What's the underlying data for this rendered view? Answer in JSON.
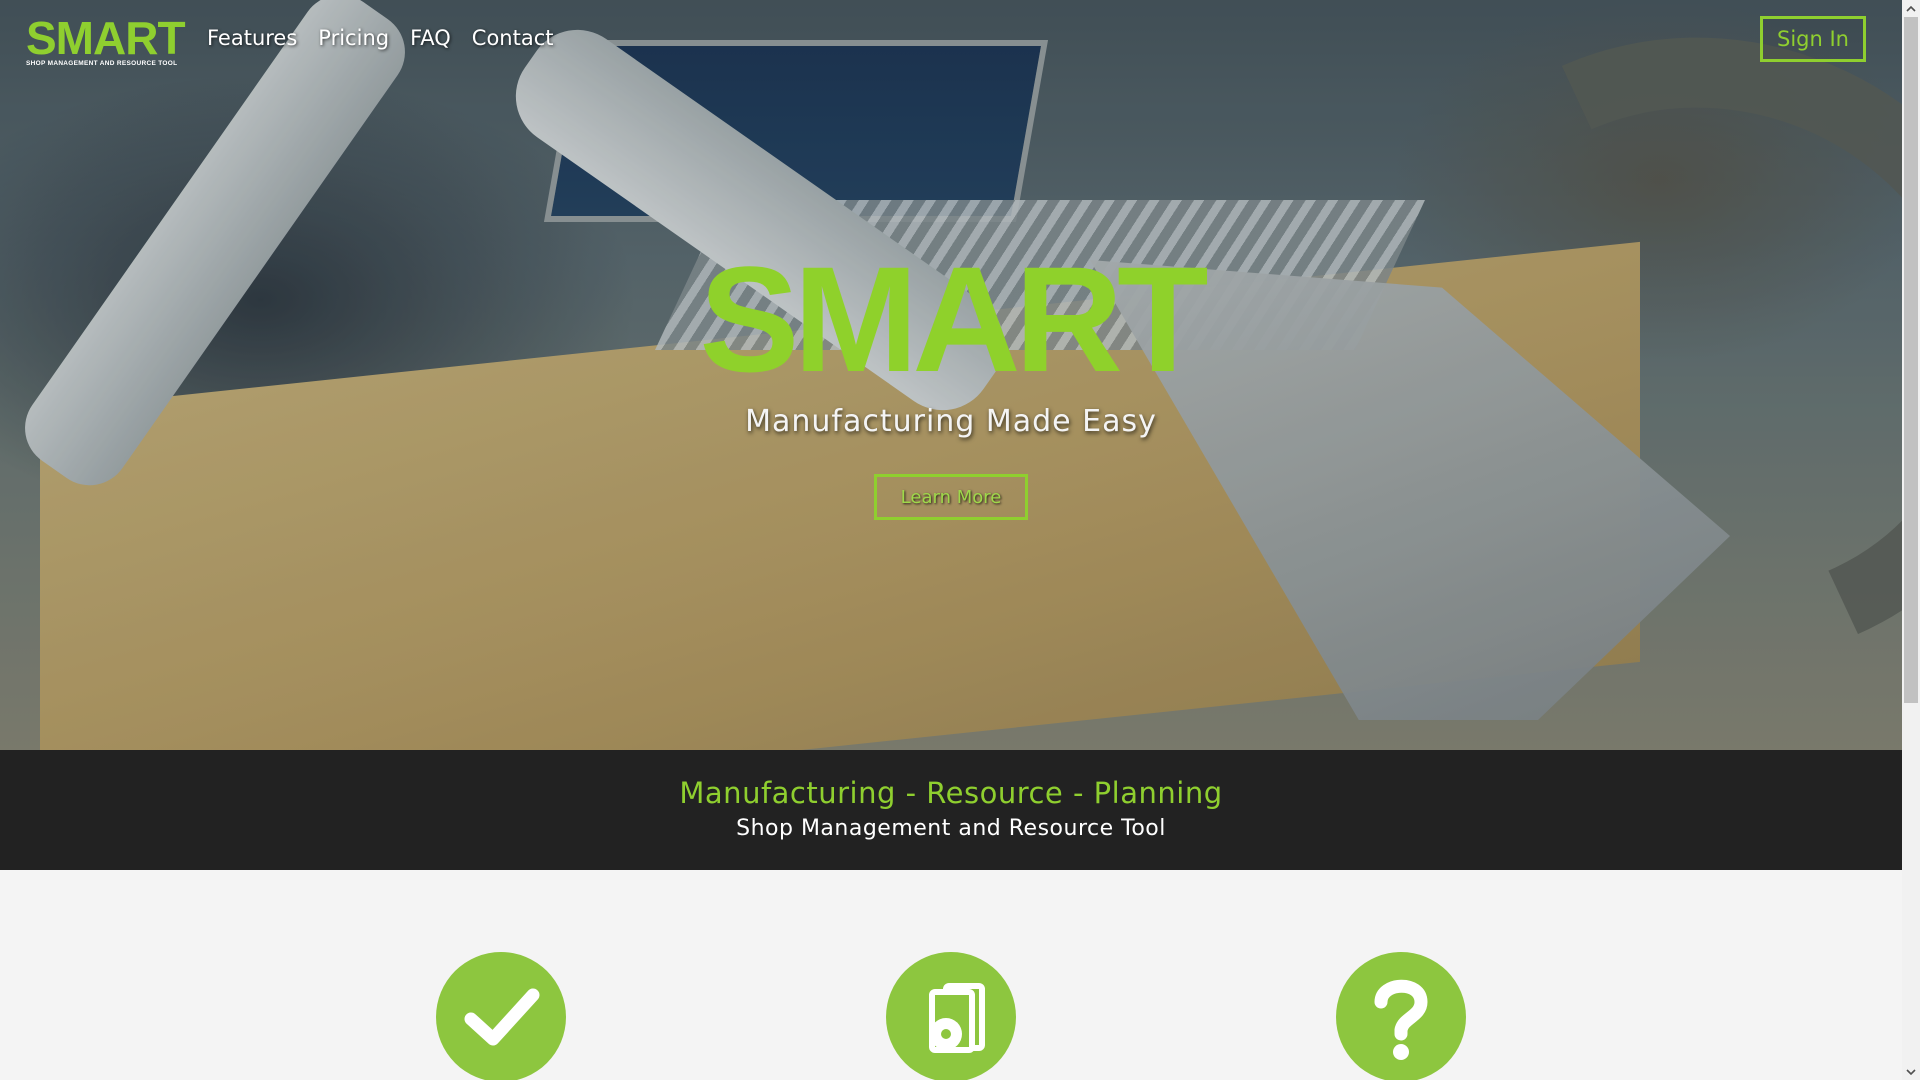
{
  "brand": {
    "logo_text": "SMART",
    "logo_tagline": "SHOP MANAGEMENT AND RESOURCE TOOL",
    "accent_color": "#8dc63f"
  },
  "nav": {
    "items": [
      {
        "label": "Features"
      },
      {
        "label": "Pricing"
      },
      {
        "label": "FAQ"
      },
      {
        "label": "Contact"
      }
    ],
    "sign_in_label": "Sign In"
  },
  "hero": {
    "title": "SMART",
    "subtitle": "Manufacturing Made Easy",
    "cta_label": "Learn More"
  },
  "band": {
    "title": "Manufacturing - Resource - Planning",
    "subtitle": "Shop Management and Resource Tool",
    "background": "#222222"
  },
  "features": {
    "icons": [
      {
        "icon": "checkmark-icon"
      },
      {
        "icon": "software-disc-icon"
      },
      {
        "icon": "question-mark-icon"
      }
    ]
  }
}
